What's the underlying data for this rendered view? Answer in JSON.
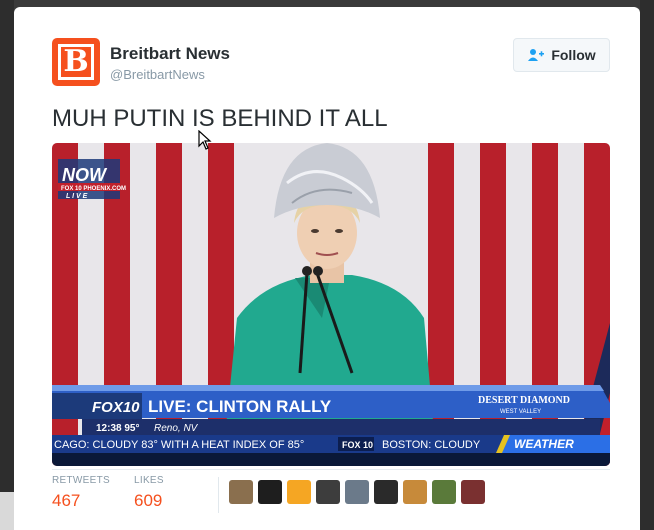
{
  "tweet": {
    "author_name": "Breitbart News",
    "author_handle": "@BreitbartNews",
    "logo_letter": "B",
    "follow_label": "Follow",
    "text": "MUH PUTIN IS BEHIND IT ALL"
  },
  "media": {
    "bug_top": "NOW",
    "bug_sub": "FOX 10 PHOENIX.COM",
    "bug_live": "L I V E",
    "station": "FOX10",
    "headline": "LIVE: CLINTON RALLY",
    "time_temp": "12:38  95°",
    "location": "Reno, NV",
    "sponsor": "DESERT DIAMOND",
    "sponsor_sub": "WEST VALLEY",
    "ticker": "CAGO: CLOUDY 83°     WITH A HEAT INDEX OF 85°",
    "ticker_logo": "FOX 10",
    "ticker_right": "BOSTON: CLOUDY",
    "weather": "WEATHER"
  },
  "stats": {
    "retweets_label": "RETWEETS",
    "retweets_value": "467",
    "likes_label": "LIKES",
    "likes_value": "609"
  },
  "colors": {
    "brand": "#f5501e",
    "text": "#292f33",
    "muted": "#8899a6"
  },
  "avatars": [
    {
      "color": "#8a6f4e",
      "label": "avatar-1"
    },
    {
      "color": "#1e1e1e",
      "label": "avatar-2"
    },
    {
      "color": "#f5a623",
      "label": "avatar-3"
    },
    {
      "color": "#3d3d3d",
      "label": "avatar-4"
    },
    {
      "color": "#6b7a8a",
      "label": "avatar-5"
    },
    {
      "color": "#2a2a2a",
      "label": "avatar-6"
    },
    {
      "color": "#c78a3a",
      "label": "avatar-7"
    },
    {
      "color": "#5a7a3a",
      "label": "avatar-8"
    },
    {
      "color": "#7a3030",
      "label": "avatar-9"
    }
  ]
}
